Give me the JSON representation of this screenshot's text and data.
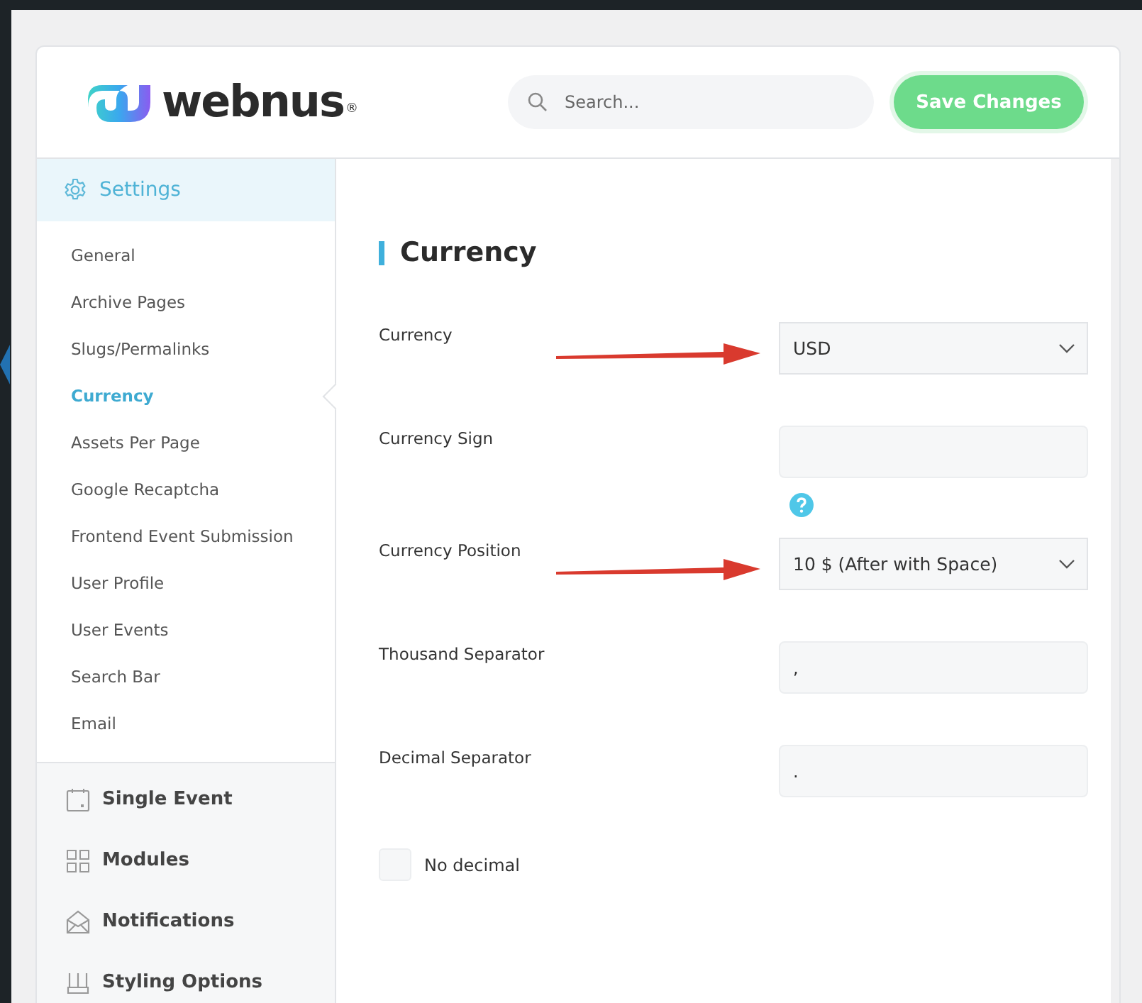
{
  "header": {
    "logo": {
      "wordmark": "webnus",
      "registered": "®"
    },
    "search": {
      "placeholder": "Search..."
    },
    "save_button": "Save Changes"
  },
  "sidebar": {
    "section": {
      "label": "Settings",
      "expanded": true
    },
    "items": [
      {
        "label": "General",
        "selected": false
      },
      {
        "label": "Archive Pages",
        "selected": false
      },
      {
        "label": "Slugs/Permalinks",
        "selected": false
      },
      {
        "label": "Currency",
        "selected": true
      },
      {
        "label": "Assets Per Page",
        "selected": false
      },
      {
        "label": "Google Recaptcha",
        "selected": false
      },
      {
        "label": "Frontend Event Submission",
        "selected": false
      },
      {
        "label": "User Profile",
        "selected": false
      },
      {
        "label": "User Events",
        "selected": false
      },
      {
        "label": "Search Bar",
        "selected": false
      },
      {
        "label": "Email",
        "selected": false
      }
    ],
    "groups": [
      {
        "label": "Single Event"
      },
      {
        "label": "Modules"
      },
      {
        "label": "Notifications"
      },
      {
        "label": "Styling Options"
      }
    ]
  },
  "content": {
    "title": "Currency",
    "fields": [
      {
        "kind": "select",
        "label": "Currency",
        "value": "USD",
        "help": false,
        "annotated": true
      },
      {
        "kind": "text",
        "label": "Currency Sign",
        "help": true,
        "annotated": false
      },
      {
        "kind": "select",
        "label": "Currency Position",
        "value": "10 $ (After with Space)",
        "help": false,
        "annotated": true
      },
      {
        "kind": "text",
        "label": "Thousand Separator",
        "value": ",",
        "help": false,
        "annotated": false
      },
      {
        "kind": "text",
        "label": "Decimal Separator",
        "value": ".",
        "help": false,
        "annotated": false
      },
      {
        "kind": "checkbox",
        "label": "No decimal",
        "checked": false
      }
    ]
  }
}
